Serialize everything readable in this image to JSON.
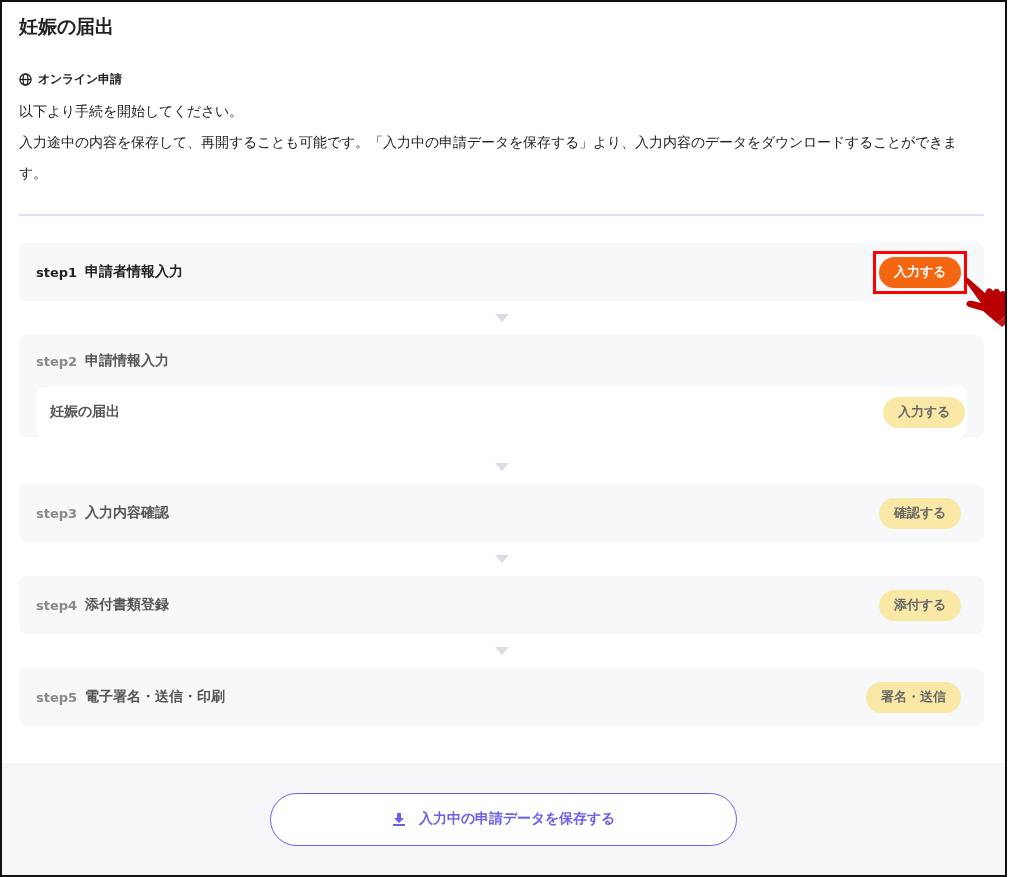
{
  "title": "妊娠の届出",
  "method": {
    "label": "オンライン申請"
  },
  "description": [
    "以下より手続を開始してください。",
    "入力途中の内容を保存して、再開することも可能です。「入力中の申請データを保存する」より、入力内容のデータをダウンロードすることができます。"
  ],
  "steps": [
    {
      "step": "step1",
      "name": "申請者情報入力",
      "disabled": false,
      "highlighted": true,
      "button": "入力する"
    },
    {
      "step": "step2",
      "name": "申請情報入力",
      "disabled": true,
      "highlighted": false,
      "items": [
        {
          "name": "妊娠の届出",
          "button": "入力する"
        }
      ]
    },
    {
      "step": "step3",
      "name": "入力内容確認",
      "disabled": true,
      "highlighted": false,
      "button": "確認する"
    },
    {
      "step": "step4",
      "name": "添付書類登録",
      "disabled": true,
      "highlighted": false,
      "button": "添付する"
    },
    {
      "step": "step5",
      "name": "電子署名・送信・印刷",
      "disabled": true,
      "highlighted": false,
      "button": "署名・送信"
    }
  ],
  "save_button": "入力中の申請データを保存する"
}
